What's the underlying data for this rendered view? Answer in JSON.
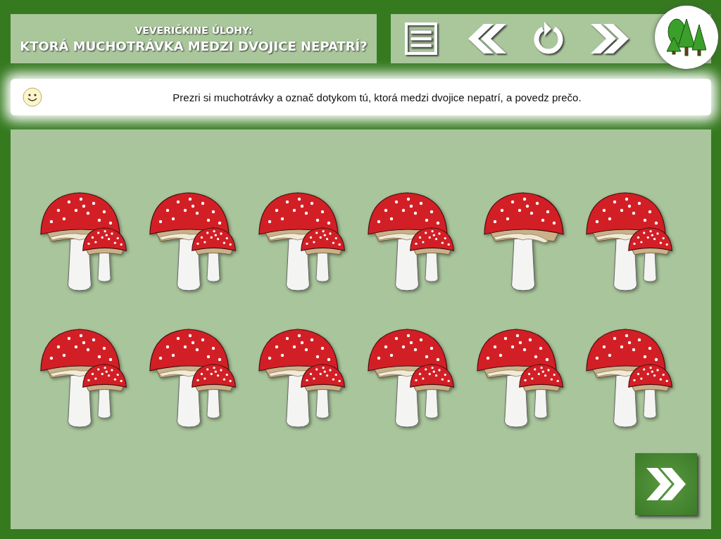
{
  "header": {
    "subtitle": "VEVERIČKINE ÚLOHY:",
    "title": "KTORÁ MUCHOTRÁVKA MEDZI DVOJICE NEPATRÍ?"
  },
  "instruction": "Prezri si muchotrávky a označ dotykom tú, ktorá medzi dvojice nepatrí, a povedz prečo.",
  "mushrooms": [
    {
      "kind": "pair"
    },
    {
      "kind": "pair"
    },
    {
      "kind": "pair"
    },
    {
      "kind": "pair"
    },
    {
      "kind": "single"
    },
    {
      "kind": "pair"
    },
    {
      "kind": "pair"
    },
    {
      "kind": "pair"
    },
    {
      "kind": "pair"
    },
    {
      "kind": "pair"
    },
    {
      "kind": "pair"
    },
    {
      "kind": "pair"
    }
  ]
}
